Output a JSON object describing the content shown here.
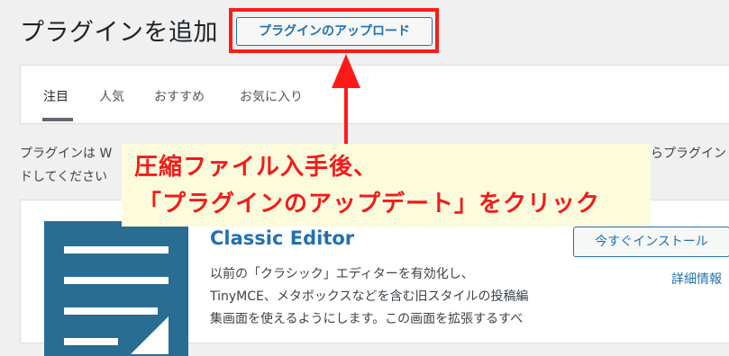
{
  "header": {
    "title": "プラグインを追加",
    "upload_button": "プラグインのアップロード"
  },
  "tabs": [
    {
      "label": "注目",
      "active": true
    },
    {
      "label": "人気",
      "active": false
    },
    {
      "label": "おすすめ",
      "active": false
    },
    {
      "label": "お気に入り",
      "active": false
    }
  ],
  "intro": {
    "line1_left": "プラグインは W",
    "line1_right": "らプラグイン",
    "line2_left": "ドしてください"
  },
  "plugin_card": {
    "name": "Classic Editor",
    "install_button": "今すぐインストール",
    "details_link": "詳細情報",
    "description": [
      "以前の「クラシック」エディターを有効化し、",
      "TinyMCE、メタボックスなどを含む旧スタイルの投稿編",
      "集画面を使えるようにします。この画面を拡張するすべ"
    ]
  },
  "annotation": {
    "line1": "圧縮ファイル入手後、",
    "line2": "「プラグインのアップデート」をクリック",
    "color": "#ff1a1a",
    "background": "#fcfbdc"
  }
}
